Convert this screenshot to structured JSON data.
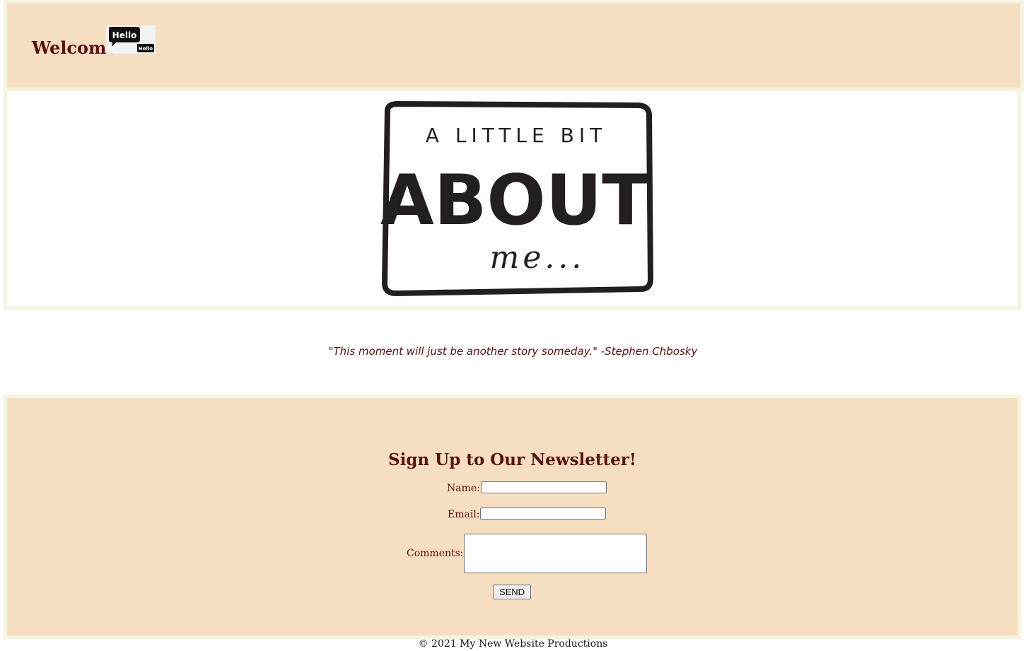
{
  "header": {
    "welcome_text": "Welcome",
    "hello_image": {
      "text_top": "Hello",
      "text_bottom": "Hello"
    }
  },
  "hero": {
    "image": {
      "line1": "A LITTLE BIT",
      "line2": "ABOUT",
      "line3": "me..."
    }
  },
  "quote": "\"This moment will just be another story someday.\" -Stephen Chbosky",
  "newsletter": {
    "title": "Sign Up to Our Newsletter!",
    "name_label": "Name:",
    "name_value": "",
    "email_label": "Email:",
    "email_value": "",
    "comments_label": "Comments:",
    "comments_value": "",
    "send_label": "SEND"
  },
  "footer": "© 2021 My New Website Productions",
  "colors": {
    "header_bg": "#f6dfc1",
    "border": "#f4f4e0",
    "text": "#5a1010"
  }
}
